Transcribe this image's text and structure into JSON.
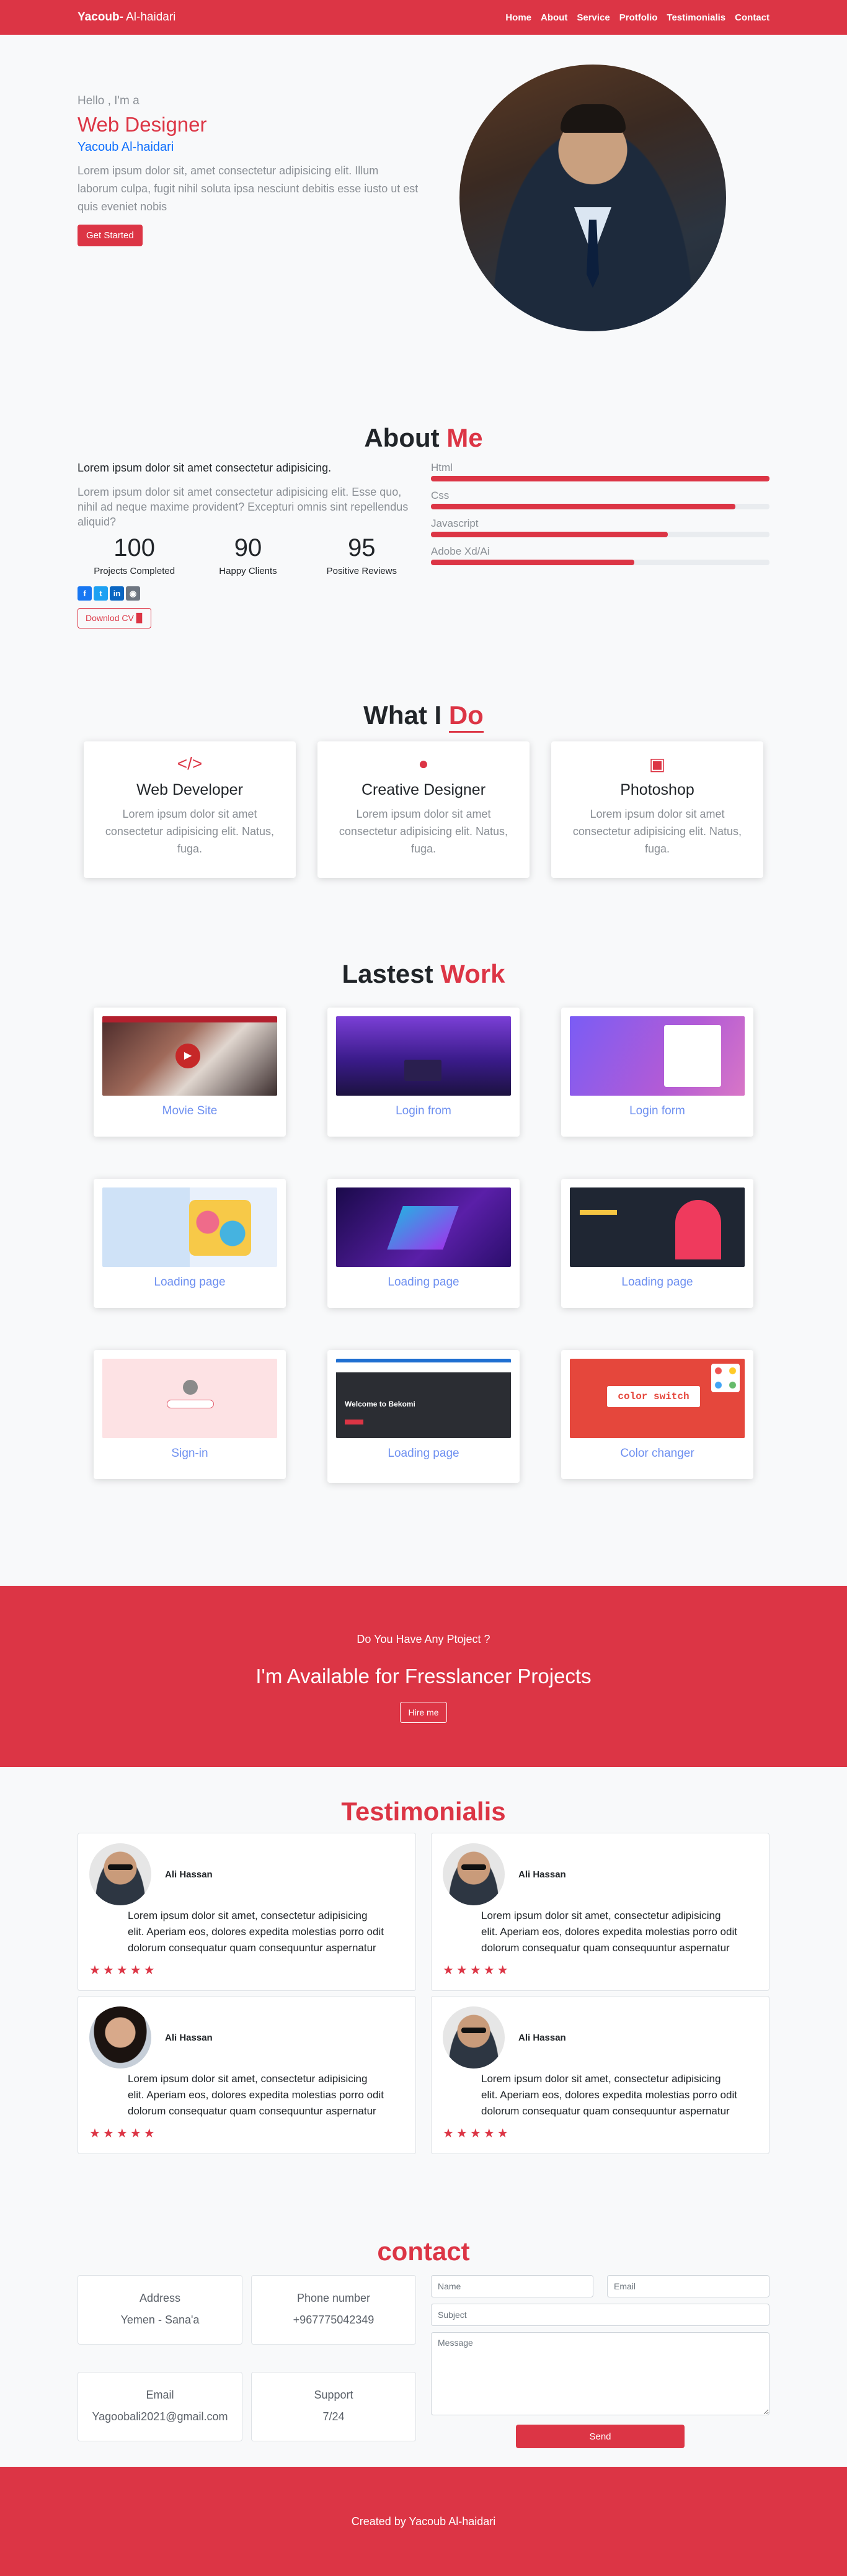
{
  "nav": {
    "brand_bold": "Yacoub-",
    "brand_rest": " Al-haidari",
    "links": [
      "Home",
      "About",
      "Service",
      "Protfolio",
      "Testimonialis",
      "Contact"
    ]
  },
  "hero": {
    "hello": "Hello , I'm a",
    "role": "Web Designer",
    "name": "Yacoub Al-haidari",
    "text": "Lorem ipsum dolor sit, amet consectetur adipisicing elit. Illum laborum culpa, fugit nihil soluta ipsa nesciunt debitis esse iusto ut est quis eveniet nobis",
    "button": "Get Started"
  },
  "about": {
    "title_a": "About ",
    "title_b": "Me",
    "lead": "Lorem ipsum dolor sit amet consectetur adipisicing.",
    "text": "Lorem ipsum dolor sit amet consectetur adipisicing elit. Esse quo, nihil ad neque maxime provident? Excepturi omnis sint repellendus aliquid?",
    "stats": [
      {
        "num": "100",
        "label": "Projects Completed"
      },
      {
        "num": "90",
        "label": "Happy Clients"
      },
      {
        "num": "95",
        "label": "Positive Reviews"
      }
    ],
    "cv_button": "Downlod CV",
    "skills": [
      {
        "name": "Html",
        "level": 100
      },
      {
        "name": "Css",
        "level": 90
      },
      {
        "name": "Javascript",
        "level": 70
      },
      {
        "name": "Adobe Xd/Ai",
        "level": 60
      }
    ]
  },
  "services": {
    "title_a": "What I ",
    "title_b": "Do",
    "items": [
      {
        "icon": "code-icon",
        "title": "Web Developer",
        "text": "Lorem ipsum dolor sit amet consectetur adipisicing elit. Natus, fuga."
      },
      {
        "icon": "lightbulb-icon",
        "title": "Creative Designer",
        "text": "Lorem ipsum dolor sit amet consectetur adipisicing elit. Natus, fuga."
      },
      {
        "icon": "images-icon",
        "title": "Photoshop",
        "text": "Lorem ipsum dolor sit amet consectetur adipisicing elit. Natus, fuga."
      }
    ]
  },
  "work": {
    "title_a": "Lastest ",
    "title_b": "Work",
    "items": [
      {
        "title": "Movie Site"
      },
      {
        "title": "Login from"
      },
      {
        "title": "Login form"
      },
      {
        "title": "Loading page"
      },
      {
        "title": "Loading page"
      },
      {
        "title": "Loading page"
      },
      {
        "title": "Sign-in"
      },
      {
        "title": "Loading page"
      },
      {
        "title": "Color changer"
      }
    ],
    "thumb_texts": {
      "bekomi": "Welcome to Bekomi",
      "color_switch": "color switch"
    }
  },
  "cta": {
    "small": "Do You Have Any Ptoject ?",
    "big": "I'm Available for Fresslancer Projects",
    "button": "Hire me"
  },
  "testimonials": {
    "title": "Testimonialis",
    "items": [
      {
        "name": "Ali Hassan",
        "text": "Lorem ipsum dolor sit amet, consectetur adipisicing elit. Aperiam eos, dolores expedita molestias porro odit dolorum consequatur quam consequuntur aspernatur",
        "stars": 5
      },
      {
        "name": "Ali Hassan",
        "text": "Lorem ipsum dolor sit amet, consectetur adipisicing elit. Aperiam eos, dolores expedita molestias porro odit dolorum consequatur quam consequuntur aspernatur",
        "stars": 5
      },
      {
        "name": "Ali Hassan",
        "text": "Lorem ipsum dolor sit amet, consectetur adipisicing elit. Aperiam eos, dolores expedita molestias porro odit dolorum consequatur quam consequuntur aspernatur",
        "stars": 5
      },
      {
        "name": "Ali Hassan",
        "text": "Lorem ipsum dolor sit amet, consectetur adipisicing elit. Aperiam eos, dolores expedita molestias porro odit dolorum consequatur quam consequuntur aspernatur",
        "stars": 5
      }
    ]
  },
  "contact": {
    "title": "contact",
    "info": [
      {
        "label": "Address",
        "value": "Yemen - Sana'a"
      },
      {
        "label": "Phone number",
        "value": "+967775042349"
      },
      {
        "label": "Email",
        "value": "Yagoobali2021@gmail.com"
      },
      {
        "label": "Support",
        "value": "7/24"
      }
    ],
    "form": {
      "name_placeholder": "Name",
      "email_placeholder": "Email",
      "subject_placeholder": "Subject",
      "message_placeholder": "Message",
      "send": "Send"
    }
  },
  "footer": {
    "text": "Created by Yacoub Al-haidari"
  },
  "colors": {
    "accent": "#dc3545",
    "link_blue": "#0d6efd",
    "work_title": "#6d8ff0"
  }
}
